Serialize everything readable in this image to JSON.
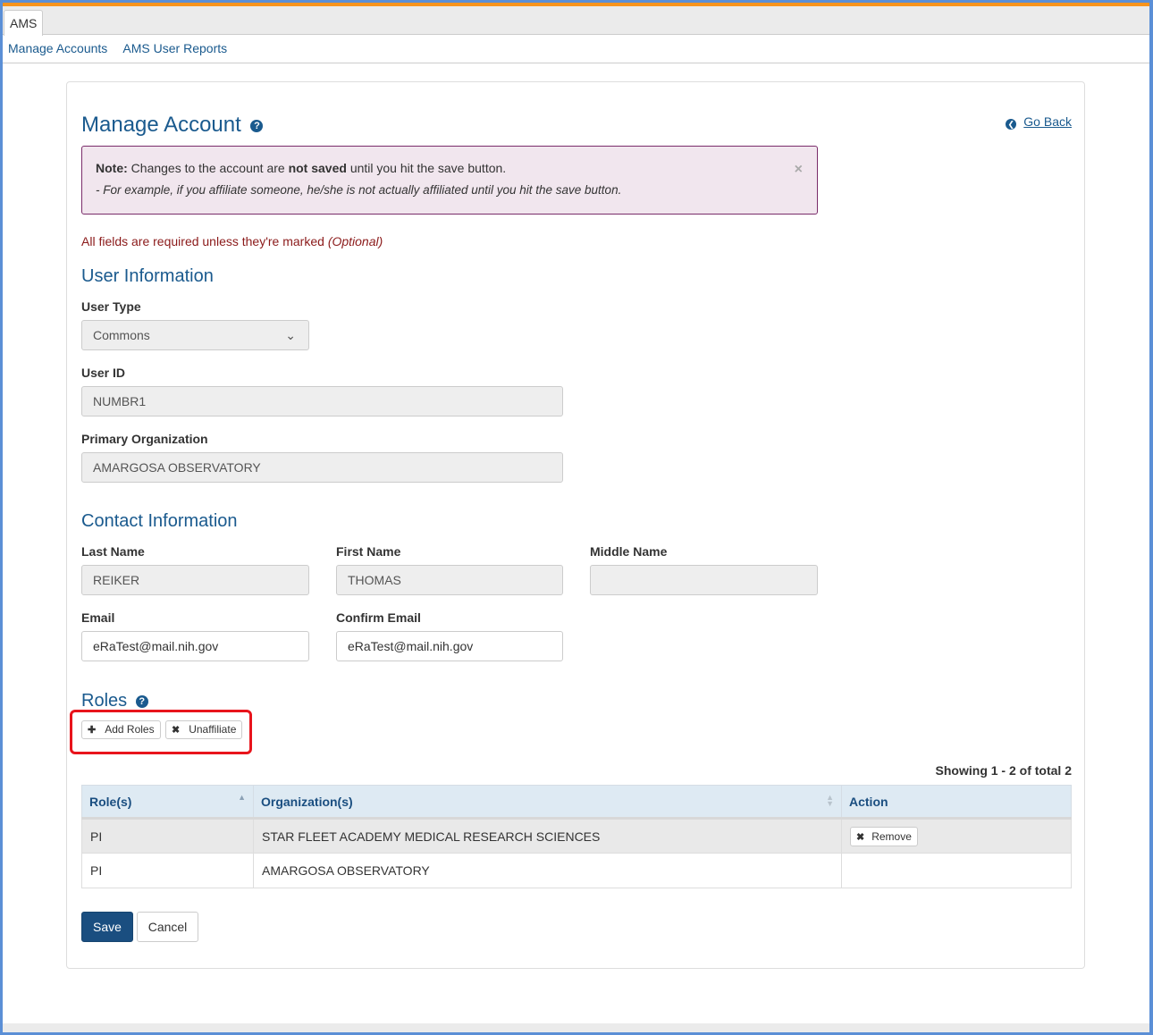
{
  "app": {
    "tab_label": "AMS",
    "accent_color": "#f7941d",
    "brand_color": "#1a5a8e"
  },
  "subnav": {
    "items": [
      {
        "label": "Manage Accounts"
      },
      {
        "label": "AMS User Reports"
      }
    ]
  },
  "page": {
    "title": "Manage Account",
    "help_icon": "question-circle-icon",
    "go_back_icon": "arrow-circle-left-icon",
    "go_back_label": "Go Back"
  },
  "alert": {
    "note_label": "Note:",
    "text_before": " Changes to the account are ",
    "bold_text": "not saved",
    "text_after": " until you hit the save button.",
    "example": "- For example, if you affiliate someone, he/she is not actually affiliated until you hit the save button.",
    "close_symbol": "×"
  },
  "required_notice": {
    "text": "All fields are required unless they're marked ",
    "optional": "(Optional)"
  },
  "user_information": {
    "heading": "User Information",
    "user_type": {
      "label": "User Type",
      "value": "Commons"
    },
    "user_id": {
      "label": "User ID",
      "value": "NUMBR1"
    },
    "primary_org": {
      "label": "Primary Organization",
      "value": "AMARGOSA OBSERVATORY"
    }
  },
  "contact_information": {
    "heading": "Contact Information",
    "last_name": {
      "label": "Last Name",
      "value": "REIKER"
    },
    "first_name": {
      "label": "First Name",
      "value": "THOMAS"
    },
    "middle_name": {
      "label": "Middle Name",
      "value": ""
    },
    "email": {
      "label": "Email",
      "value": "eRaTest@mail.nih.gov"
    },
    "confirm_email": {
      "label": "Confirm Email",
      "value": "eRaTest@mail.nih.gov"
    }
  },
  "roles": {
    "heading": "Roles",
    "add_roles_label": "Add Roles",
    "unaffiliate_label": "Unaffiliate",
    "showing": "Showing 1 - 2 of total 2",
    "columns": [
      "Role(s)",
      "Organization(s)",
      "Action"
    ],
    "rows": [
      {
        "role": "PI",
        "organization": "STAR FLEET ACADEMY MEDICAL RESEARCH SCIENCES",
        "action": "Remove"
      },
      {
        "role": "PI",
        "organization": "AMARGOSA OBSERVATORY",
        "action": ""
      }
    ]
  },
  "actions": {
    "save_label": "Save",
    "cancel_label": "Cancel"
  }
}
